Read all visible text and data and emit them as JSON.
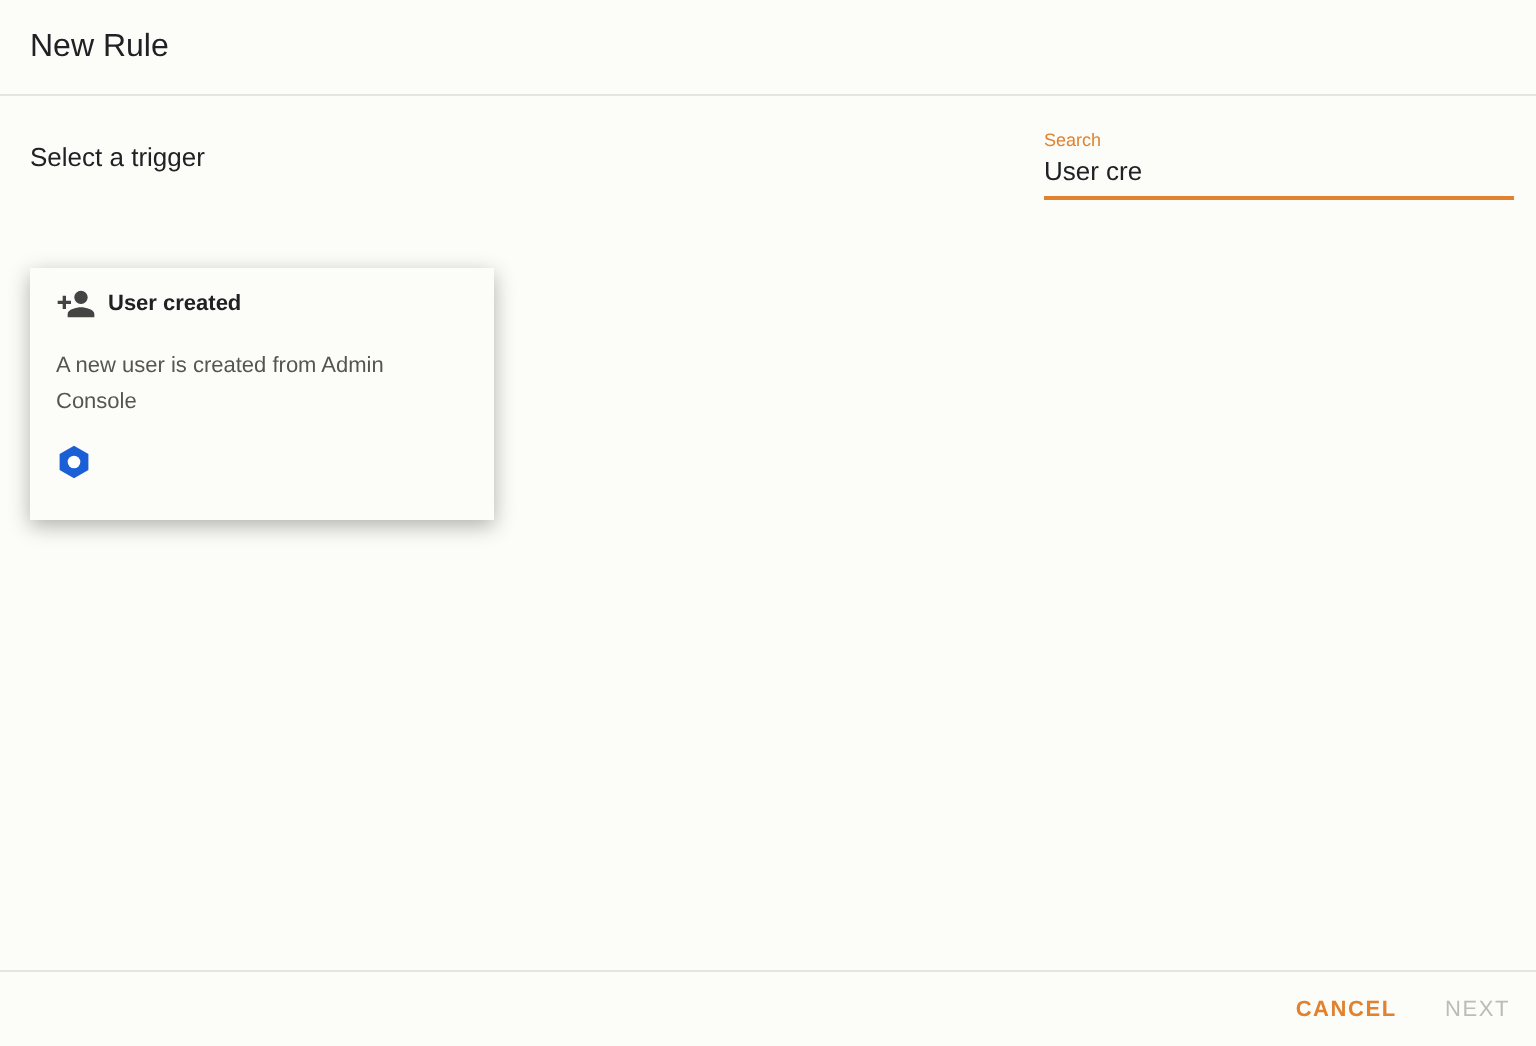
{
  "window": {
    "title": "New Rule"
  },
  "trigger": {
    "label": "Select a trigger"
  },
  "search": {
    "label": "Search",
    "value": "User cre",
    "focused": true
  },
  "cards": [
    {
      "title": "User created",
      "description": "A new user is created from Admin Console",
      "hovered": true
    }
  ],
  "buttons": [
    {
      "label": "CANCEL",
      "disabled": false
    },
    {
      "label": "NEXT",
      "disabled": true
    }
  ]
}
